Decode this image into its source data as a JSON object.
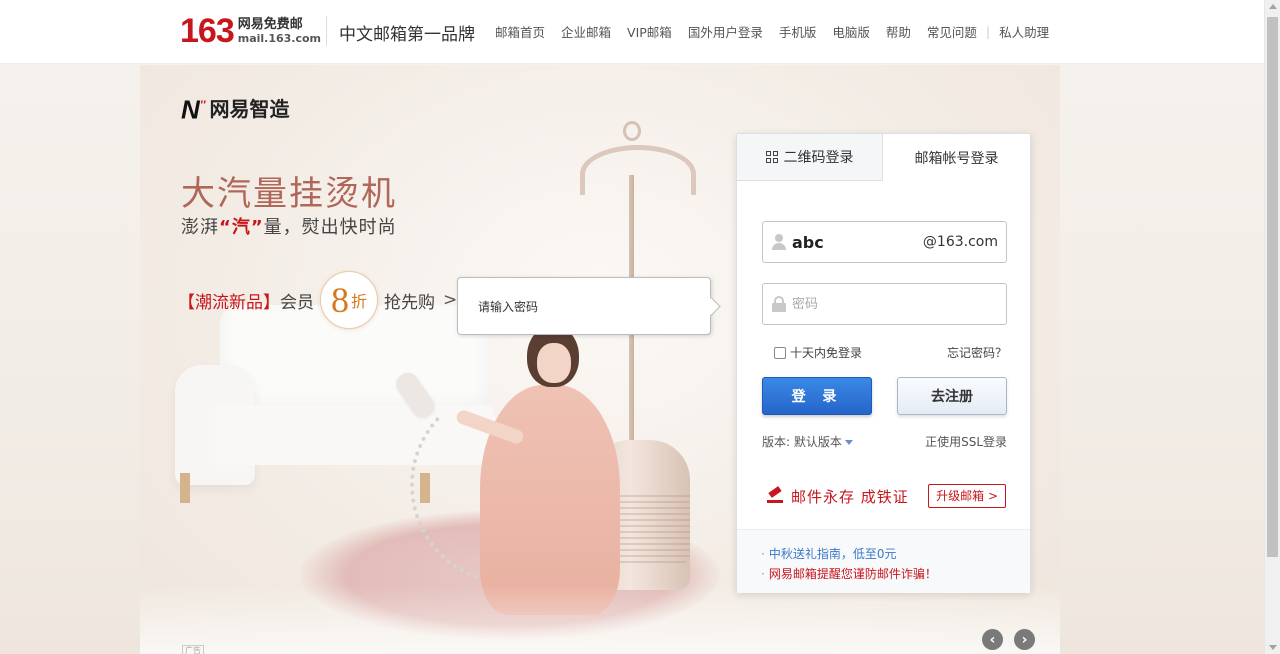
{
  "header": {
    "logo_number": "163",
    "logo_cn": "网易免费邮",
    "logo_domain": "mail.163.com",
    "slogan": "中文邮箱第一品牌",
    "nav": [
      "邮箱首页",
      "企业邮箱",
      "VIP邮箱",
      "国外用户登录",
      "手机版",
      "电脑版",
      "帮助",
      "常见问题",
      "私人助理"
    ],
    "nav_separator": "|"
  },
  "ad": {
    "brand_mark": "N",
    "brand_name": "网易智造",
    "title": "大汽量挂烫机",
    "subtitle_pre": "澎湃",
    "subtitle_hl": "“汽”",
    "subtitle_post": "量，熨出快时尚",
    "promo_tag": "【潮流新品】",
    "promo_member": "会员",
    "discount_num": "8",
    "discount_unit": "折",
    "promo_action": "抢先购",
    "promo_arrow": ">",
    "ad_mark": "广告"
  },
  "tooltip": {
    "text": "请输入密码"
  },
  "login": {
    "tabs": {
      "qr": "二维码登录",
      "account": "邮箱帐号登录"
    },
    "username_value": "abc",
    "domain_suffix": "@163.com",
    "password_placeholder": "密码",
    "remember_label": "十天内免登录",
    "forgot_label": "忘记密码？",
    "login_button": "登 录",
    "register_button": "去注册",
    "version_label": "版本: 默认版本",
    "ssl_label": "正使用SSL登录",
    "promo_text": "邮件永存 成铁证",
    "upgrade_label": "升级邮箱",
    "upgrade_arrow": ">"
  },
  "notices": {
    "bullet": "·",
    "items": [
      "中秋送礼指南，低至0元",
      "网易邮箱提醒您谨防邮件诈骗！"
    ]
  },
  "carousel": {
    "prev": "‹",
    "next": "›"
  },
  "colors": {
    "brand_red": "#c8161d",
    "login_blue": "#2e75db",
    "link_blue": "#3c78c8"
  }
}
